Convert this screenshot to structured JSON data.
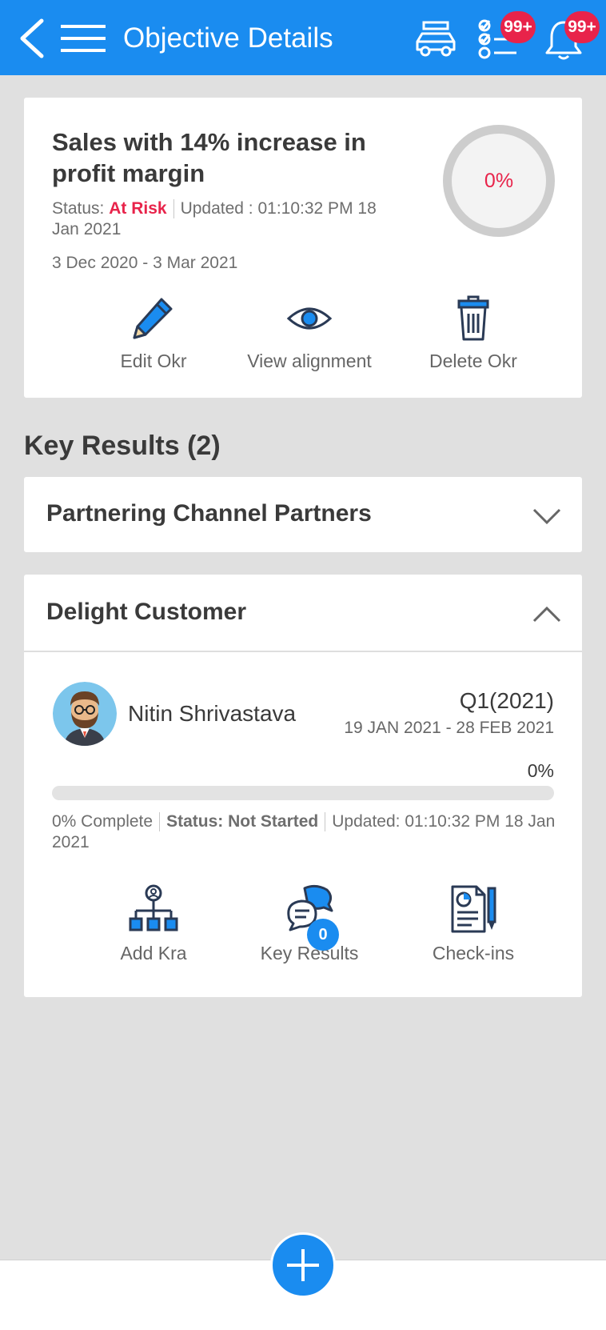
{
  "header": {
    "title": "Objective Details",
    "tasks_badge": "99+",
    "notifications_badge": "99+",
    "icons": [
      "back-arrow-icon",
      "hamburger-menu-icon",
      "car-icon",
      "checklist-icon",
      "bell-icon"
    ]
  },
  "objective": {
    "title": "Sales with 14% increase in profit margin",
    "status_label": "Status:",
    "status_value": "At Risk",
    "updated": "Updated : 01:10:32 PM 18 Jan 2021",
    "date_range": "3 Dec 2020 - 3 Mar 2021",
    "progress_text": "0%",
    "progress": 0,
    "actions": [
      {
        "label": "Edit Okr",
        "icon": "pencil-icon"
      },
      {
        "label": "View alignment",
        "icon": "eye-icon"
      },
      {
        "label": "Delete Okr",
        "icon": "trash-icon"
      }
    ]
  },
  "key_results": {
    "heading": "Key Results (2)",
    "items": [
      {
        "title": "Partnering Channel Partners",
        "expanded": false
      },
      {
        "title": "Delight Customer",
        "expanded": true,
        "owner": "Nitin Shrivastava",
        "quarter": "Q1(2021)",
        "range": "19 JAN 2021 - 28 FEB 2021",
        "percent": "0%",
        "progress": 0,
        "complete": "0% Complete",
        "status": "Status: Not Started",
        "updated": "Updated: 01:10:32 PM 18 Jan 2021",
        "actions": [
          {
            "label": "Add Kra",
            "icon": "org-chart-icon"
          },
          {
            "label": "Key Results",
            "icon": "chat-bubbles-icon",
            "badge": "0"
          },
          {
            "label": "Check-ins",
            "icon": "document-pen-icon"
          }
        ]
      }
    ]
  },
  "colors": {
    "primary": "#1a8cf0",
    "danger": "#e8234a"
  },
  "fab_icon": "plus-icon"
}
